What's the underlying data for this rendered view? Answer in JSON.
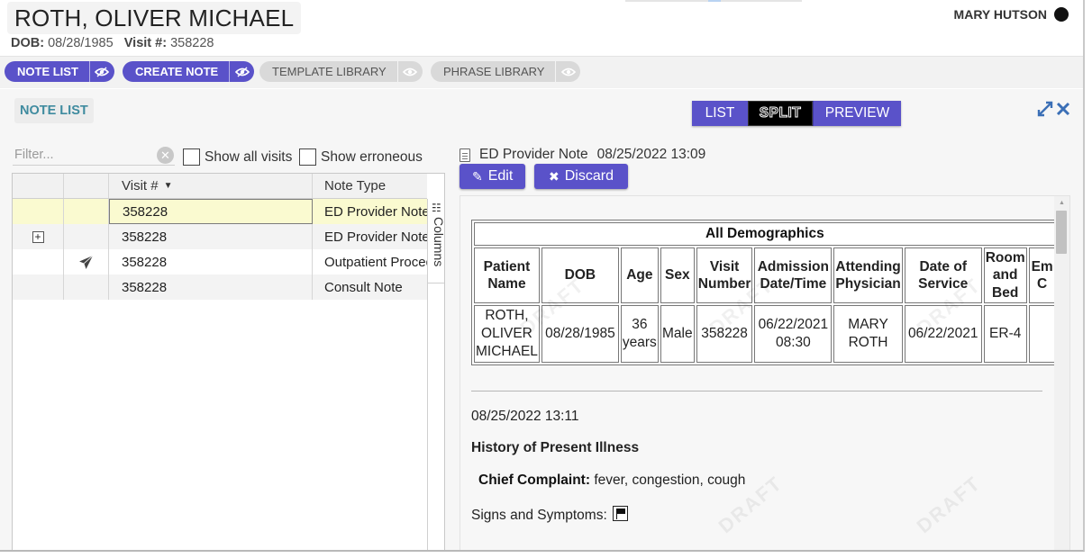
{
  "patient": {
    "name": "ROTH, OLIVER MICHAEL",
    "dob_label": "DOB:",
    "dob": "08/28/1985",
    "visit_label": "Visit #:",
    "visit": "358228"
  },
  "user": {
    "name": "MARY HUTSON"
  },
  "toolbar": {
    "note_list": "NOTE LIST",
    "create_note": "CREATE NOTE",
    "template_library": "TEMPLATE LIBRARY",
    "phrase_library": "PHRASE LIBRARY"
  },
  "section_title": "NOTE LIST",
  "view_modes": {
    "list": "LIST",
    "split": "SPLIT",
    "preview": "PREVIEW",
    "selected": "SPLIT"
  },
  "filter": {
    "placeholder": "Filter...",
    "show_all_visits": "Show all visits",
    "show_erroneous": "Show erroneous"
  },
  "grid": {
    "columns": [
      "",
      "",
      "Visit #",
      "Note Type"
    ],
    "columns_tab": "Columns",
    "rows": [
      {
        "visit": "358228",
        "note_type": "ED Provider Note",
        "selected": true
      },
      {
        "visit": "358228",
        "note_type": "ED Provider Note",
        "expand": true
      },
      {
        "visit": "358228",
        "note_type": "Outpatient Procedure",
        "sent": true
      },
      {
        "visit": "358228",
        "note_type": "Consult Note"
      }
    ]
  },
  "note": {
    "title": "ED Provider Note",
    "datetime": "08/25/2022 13:09",
    "edit_label": "Edit",
    "discard_label": "Discard",
    "demographics": {
      "caption": "All Demographics",
      "headers": [
        "Patient Name",
        "DOB",
        "Age",
        "Sex",
        "Visit Number",
        "Admission Date/Time",
        "Attending Physician",
        "Date of Service",
        "Room and Bed",
        "Em C"
      ],
      "values": [
        "ROTH, OLIVER MICHAEL",
        "08/28/1985",
        "36 years",
        "Male",
        "358228",
        "06/22/2021 08:30",
        "MARY ROTH",
        "06/22/2021",
        "ER-4",
        ""
      ]
    },
    "body_datetime": "08/25/2022 13:11",
    "hpi_heading": "History of Present Illness",
    "chief_complaint_label": "Chief Complaint:",
    "chief_complaint": "fever, congestion, cough",
    "signs_symptoms_label": "Signs and Symptoms:",
    "watermark": "DRAFT"
  }
}
